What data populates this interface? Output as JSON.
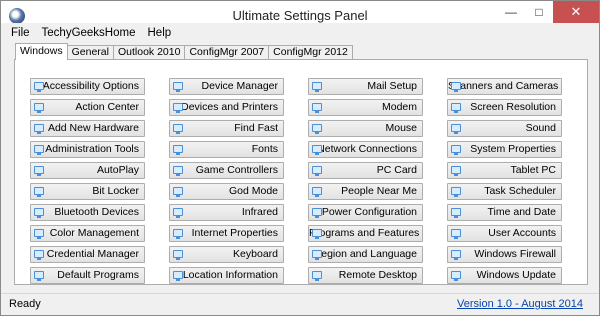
{
  "window": {
    "title": "Ultimate Settings Panel"
  },
  "menu": [
    "File",
    "TechyGeeksHome",
    "Help"
  ],
  "tabs": [
    "Windows",
    "General",
    "Outlook 2010",
    "ConfigMgr 2007",
    "ConfigMgr 2012"
  ],
  "active_tab": "Windows",
  "buttons": [
    [
      "Accessibility Options",
      "Device Manager",
      "Mail Setup",
      "Scanners and Cameras"
    ],
    [
      "Action Center",
      "Devices and Printers",
      "Modem",
      "Screen Resolution"
    ],
    [
      "Add New Hardware",
      "Find Fast",
      "Mouse",
      "Sound"
    ],
    [
      "Administration Tools",
      "Fonts",
      "Network Connections",
      "System Properties"
    ],
    [
      "AutoPlay",
      "Game Controllers",
      "PC Card",
      "Tablet PC"
    ],
    [
      "Bit Locker",
      "God Mode",
      "People Near Me",
      "Task Scheduler"
    ],
    [
      "Bluetooth Devices",
      "Infrared",
      "Power Configuration",
      "Time and Date"
    ],
    [
      "Color Management",
      "Internet Properties",
      "Programs and Features",
      "User Accounts"
    ],
    [
      "Credential Manager",
      "Keyboard",
      "Region and Language",
      "Windows Firewall"
    ],
    [
      "Default Programs",
      "Location Information",
      "Remote Desktop",
      "Windows Update"
    ]
  ],
  "status": {
    "text": "Ready",
    "version_link": "Version 1.0 - August 2014"
  },
  "colors": {
    "link": "#0645ad",
    "close_button": "#c75050",
    "button_icon": "#4a90d9"
  }
}
